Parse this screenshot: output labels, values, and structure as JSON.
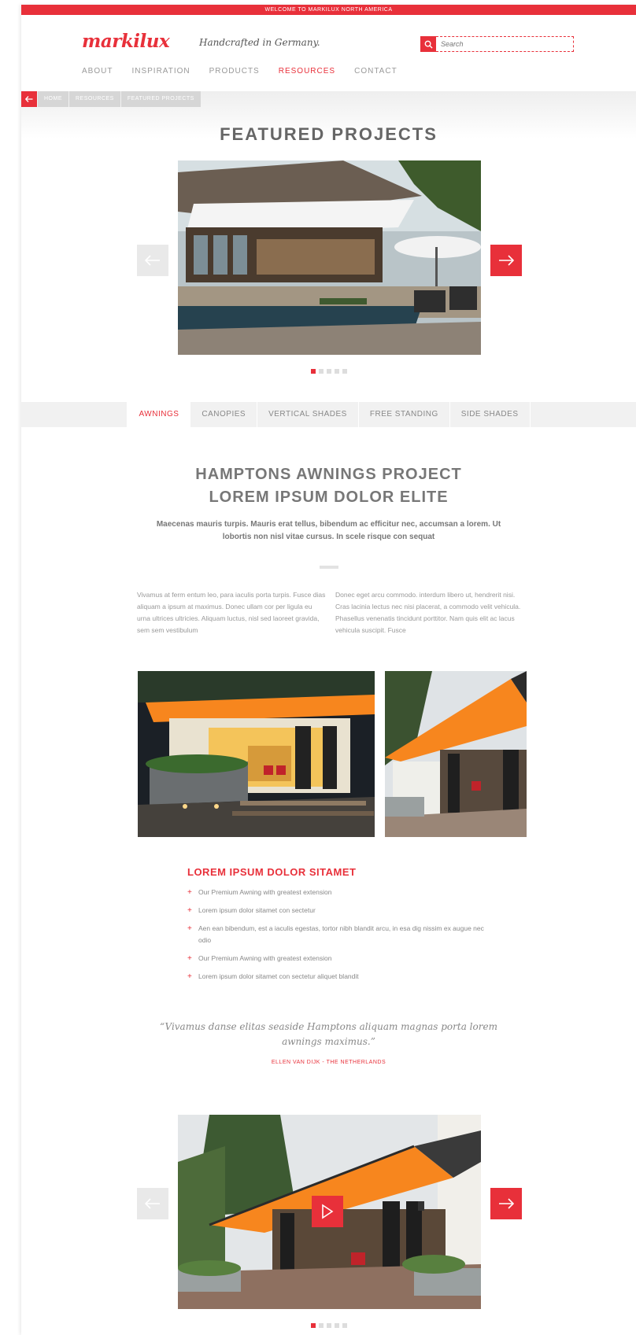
{
  "topbar": {
    "text": "WELCOME TO MARKILUX NORTH AMERICA"
  },
  "header": {
    "logo": "markilux",
    "tagline": "Handcrafted in Germany.",
    "search_placeholder": "Search",
    "nav": [
      {
        "label": "ABOUT",
        "active": false
      },
      {
        "label": "INSPIRATION",
        "active": false
      },
      {
        "label": "PRODUCTS",
        "active": false
      },
      {
        "label": "RESOURCES",
        "active": true
      },
      {
        "label": "CONTACT",
        "active": false
      }
    ]
  },
  "breadcrumb": [
    "HOME",
    "RESOURCES",
    "FEATURED PROJECTS"
  ],
  "hero": {
    "title": "FEATURED PROJECTS",
    "slide_count": 5,
    "active_slide": 1
  },
  "tabs": [
    {
      "label": "AWNINGS",
      "active": true
    },
    {
      "label": "CANOPIES",
      "active": false
    },
    {
      "label": "VERTICAL SHADES",
      "active": false
    },
    {
      "label": "FREE STANDING",
      "active": false
    },
    {
      "label": "SIDE SHADES",
      "active": false
    }
  ],
  "project": {
    "title_line1": "HAMPTONS AWNINGS PROJECT",
    "title_line2": "LOREM IPSUM DOLOR ELITE",
    "lead": "Maecenas mauris turpis. Mauris erat tellus, bibendum ac efficitur nec, accumsan a lorem. Ut lobortis non nisl vitae cursus. In scele risque con sequat",
    "col_left": "Vivamus at ferm entum leo, para iaculis porta turpis. Fusce dias aliquam a ipsum at maximus. Donec ullam cor per ligula eu urna ultrices ultricies. Aliquam luctus, nisl sed laoreet gravida, sem sem vestibulum",
    "col_right": "Donec eget arcu commodo. interdum libero ut, hendrerit nisi. Cras lacinia lectus nec nisi placerat, a commodo velit vehicula. Phasellus venenatis tincidunt porttitor. Nam quis elit ac lacus vehicula suscipit. Fusce",
    "subheading": "LOREM IPSUM DOLOR SITAMET",
    "bullets": [
      "Our Premium Awning with greatest extension",
      "Lorem ipsum dolor sitamet con sectetur",
      "Aen ean bibendum, est a iaculis egestas, tortor nibh blandit arcu, in esa dig nissim ex augue nec odio",
      "Our Premium Awning with greatest extension",
      "Lorem ipsum dolor sitamet con sectetur aliquet blandit"
    ],
    "quote": "“Vivamus danse elitas seaside Hamptons aliquam magnas porta lorem awnings maximus.”",
    "quote_author": "ELLEN VAN DIJK - THE NETHERLANDS"
  },
  "colors": {
    "accent": "#e8303a",
    "awning_orange": "#f7861e",
    "light_gray": "#e9e9e9"
  },
  "icons": {
    "search": "search-icon",
    "back": "arrow-left-icon",
    "prev": "arrow-left-icon",
    "next": "arrow-right-icon",
    "play": "play-icon"
  }
}
